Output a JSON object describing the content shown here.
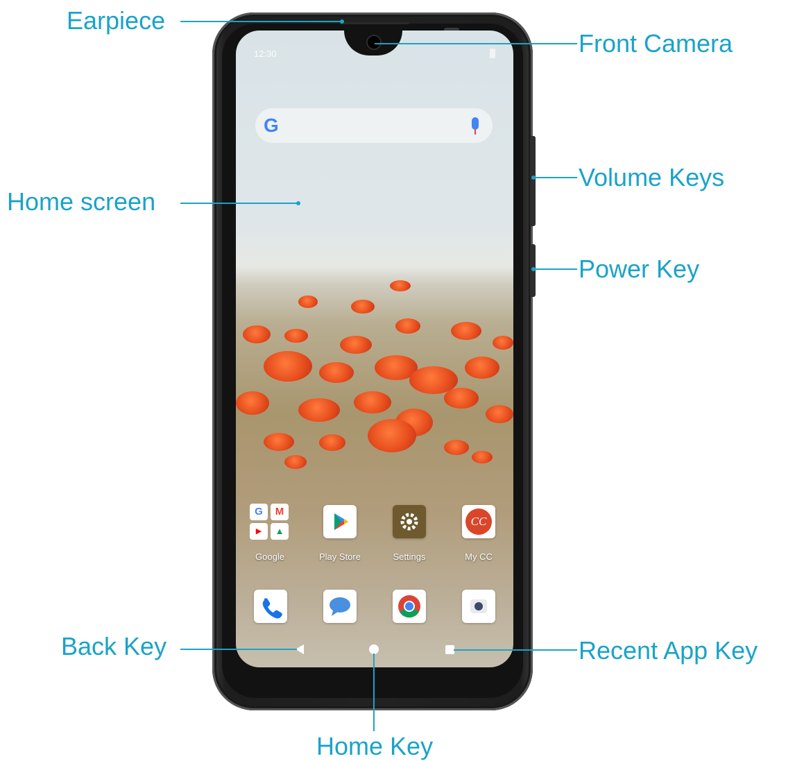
{
  "callouts": {
    "earpiece": "Earpiece",
    "front_camera": "Front Camera",
    "home_screen": "Home screen",
    "volume_keys": "Volume Keys",
    "power_key": "Power Key",
    "back_key": "Back Key",
    "recent_app_key": "Recent App Key",
    "home_key": "Home Key"
  },
  "phone_screen": {
    "status_time": "12:30",
    "search_logo": "G",
    "apps_row1": [
      {
        "label": "Google",
        "icon": "google-folder-icon"
      },
      {
        "label": "Play Store",
        "icon": "play-store-icon"
      },
      {
        "label": "Settings",
        "icon": "gear-icon"
      },
      {
        "label": "My CC",
        "icon": "my-cc-icon"
      }
    ],
    "dock": [
      {
        "icon": "phone-icon"
      },
      {
        "icon": "messages-icon"
      },
      {
        "icon": "chrome-icon"
      },
      {
        "icon": "camera-icon"
      }
    ],
    "folder_minis": [
      "G",
      "M",
      "▶",
      "▲"
    ],
    "my_cc_text": "CC"
  },
  "colors": {
    "callout": "#1aa3c9",
    "phone_body": "#1e1e1e"
  }
}
